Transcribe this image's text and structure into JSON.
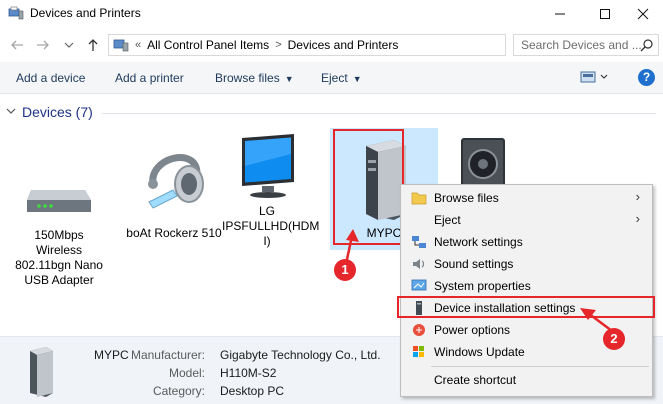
{
  "window": {
    "title": "Devices and Printers"
  },
  "address": {
    "overflow": "«",
    "crumbs": [
      "All Control Panel Items",
      "Devices and Printers"
    ],
    "search_placeholder": "Search Devices and ..."
  },
  "toolbar": {
    "add_device": "Add a device",
    "add_printer": "Add a printer",
    "browse_files": "Browse files",
    "eject": "Eject",
    "help": "?"
  },
  "group": {
    "title": "Devices (7)"
  },
  "devices": [
    {
      "label": "150Mbps Wireless 802.11bgn Nano USB Adapter",
      "lines": [
        "150Mbps",
        "Wireless",
        "802.11bgn Nano",
        "USB Adapter"
      ],
      "icon": "router-icon"
    },
    {
      "label": "boAt Rockerz 510",
      "lines": [
        "boAt Rockerz 510"
      ],
      "icon": "headset-icon"
    },
    {
      "label": "LG IPSFULLHD(HDMI)",
      "lines": [
        "LG",
        "IPSFULLHD(HDM",
        "I)"
      ],
      "icon": "monitor-icon"
    },
    {
      "label": "MYPC",
      "lines": [
        "MYPC"
      ],
      "icon": "computer-tower-icon"
    },
    {
      "label": "",
      "lines": [],
      "icon": "speaker-icon"
    }
  ],
  "annotations": {
    "badge1": "1",
    "badge2": "2",
    "accent": "#e5262a"
  },
  "context_menu": {
    "items": [
      {
        "label": "Browse files",
        "icon": "folder-icon",
        "submenu": true
      },
      {
        "label": "Eject",
        "icon": "blank-icon",
        "submenu": true
      },
      {
        "label": "Network settings",
        "icon": "network-icon",
        "submenu": false
      },
      {
        "label": "Sound settings",
        "icon": "speaker-small-icon",
        "submenu": false
      },
      {
        "label": "System properties",
        "icon": "system-icon",
        "submenu": false
      },
      {
        "label": "Device installation settings",
        "icon": "computer-small-icon",
        "submenu": false
      },
      {
        "label": "Power options",
        "icon": "power-icon",
        "submenu": false
      },
      {
        "label": "Windows Update",
        "icon": "windows-update-icon",
        "submenu": false
      },
      {
        "label": "Create shortcut",
        "icon": "blank-icon",
        "submenu": false
      }
    ]
  },
  "details": {
    "name": "MYPC",
    "manufacturer_label": "Manufacturer:",
    "manufacturer": "Gigabyte Technology Co., Ltd.",
    "model_label": "Model:",
    "model": "H110M-S2",
    "category_label": "Category:",
    "category": "Desktop PC"
  }
}
